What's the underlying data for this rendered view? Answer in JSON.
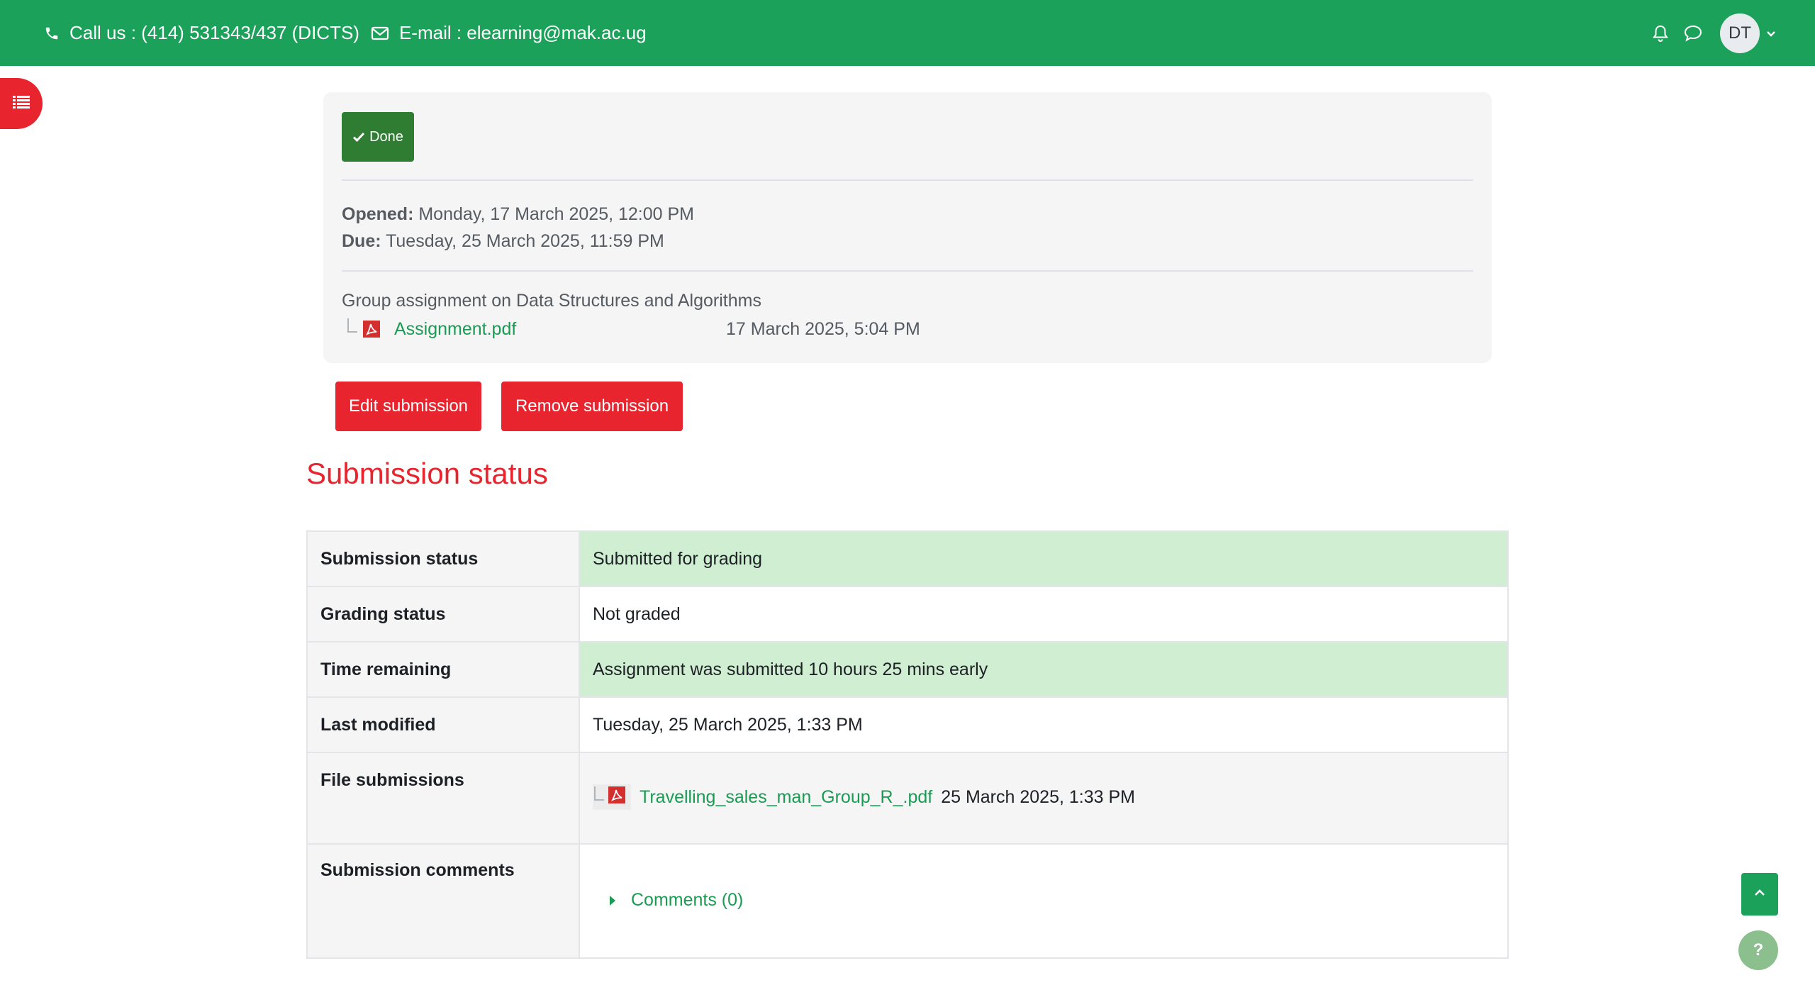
{
  "topbar": {
    "phone_text": "Call us : (414) 531343/437 (DICTS)",
    "email_text": "E-mail : elearning@mak.ac.ug",
    "user_initials": "DT",
    "bg_color": "#1ba159"
  },
  "activity": {
    "done_label": "Done",
    "opened_label": "Opened:",
    "opened_value": "Monday, 17 March 2025, 12:00 PM",
    "due_label": "Due:",
    "due_value": "Tuesday, 25 March 2025, 11:59 PM",
    "intro": "Group assignment on Data Structures and Algorithms",
    "attachment": {
      "name": "Assignment.pdf",
      "date": "17 March 2025, 5:04 PM",
      "icon": "pdf-icon"
    }
  },
  "actions": {
    "edit_label": "Edit submission",
    "remove_label": "Remove submission"
  },
  "status_section": {
    "title": "Submission status",
    "rows": [
      {
        "label": "Submission status",
        "value": "Submitted for grading",
        "highlight": "success"
      },
      {
        "label": "Grading status",
        "value": "Not graded",
        "highlight": "none"
      },
      {
        "label": "Time remaining",
        "value": "Assignment was submitted 10 hours 25 mins early",
        "highlight": "success"
      },
      {
        "label": "Last modified",
        "value": "Tuesday, 25 March 2025, 1:33 PM",
        "highlight": "none"
      },
      {
        "label": "File submissions",
        "file_name": "Travelling_sales_man_Group_R_.pdf",
        "file_date": "25 March 2025, 1:33 PM"
      },
      {
        "label": "Submission comments",
        "comments_link": "Comments (0)"
      }
    ]
  },
  "colors": {
    "accent_red": "#e8242f",
    "brand_green": "#1ba159",
    "link_green": "#1a9b54",
    "success_bg": "#cfeed2"
  },
  "floating": {
    "help_label": "?"
  }
}
